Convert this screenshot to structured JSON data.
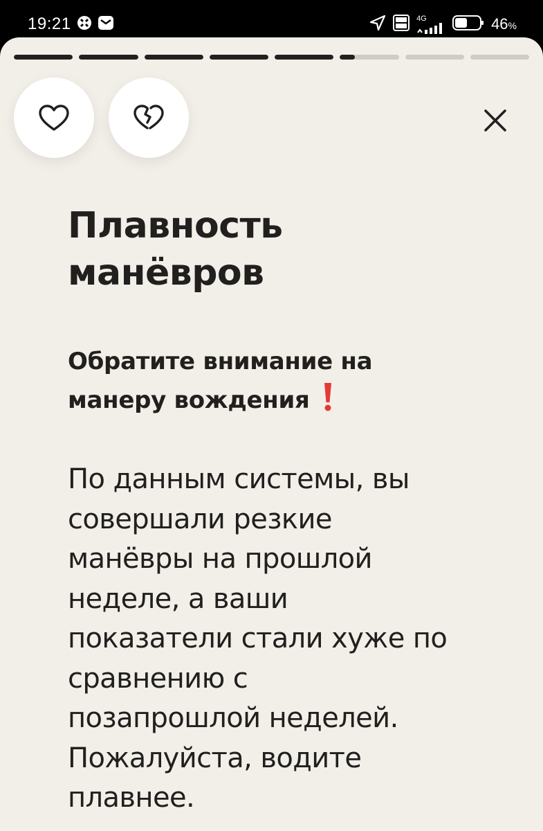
{
  "status_bar": {
    "time": "19:21",
    "network_label_top": "4G",
    "volte_label": "Vo LTE",
    "battery_percent": "46",
    "battery_unit": "%",
    "icons": [
      "location-arrow-icon",
      "volte-icon",
      "signal-icon",
      "battery-icon",
      "app-notification-icon",
      "mail-icon"
    ]
  },
  "progress": {
    "segments": [
      1,
      1,
      1,
      1,
      1,
      0.25,
      0,
      0
    ],
    "colors": {
      "active": "#21201f",
      "inactive": "#cfccc6"
    }
  },
  "actions": {
    "like_icon": "heart-icon",
    "dislike_icon": "broken-heart-icon",
    "close_icon": "close-icon"
  },
  "story": {
    "title_line1": "Плавность",
    "title_line2": "манёвров",
    "subtitle_line1": "Обратите внимание на",
    "subtitle_line2": "манеру вождения",
    "subtitle_emoji": "exclamation-mark-icon",
    "body_lines": [
      "По данным системы, вы",
      "совершали резкие",
      "манёвры на прошлой",
      "неделе, а ваши",
      "показатели стали хуже по",
      "сравнению с",
      "позапрошлой неделей.",
      "Пожалуйста, водите",
      "плавнее."
    ]
  },
  "colors": {
    "background": "#f2efe8",
    "text": "#21201f",
    "accent_red": "#e53935"
  }
}
